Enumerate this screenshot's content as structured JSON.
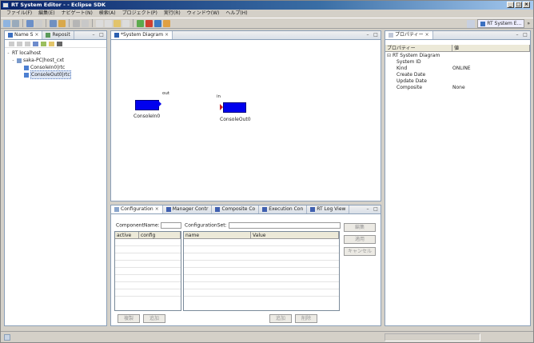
{
  "window": {
    "title": "RT System Editor - - Eclipse SDK",
    "controls": [
      "_",
      "□",
      "×"
    ]
  },
  "menu": [
    "ファイル(F)",
    "編集(E)",
    "ナビゲート(N)",
    "検索(A)",
    "プロジェクト(P)",
    "実行(R)",
    "ウィンドウ(W)",
    "ヘルプ(H)"
  ],
  "perspective": {
    "label": "RT System E..."
  },
  "navigator": {
    "tabs": [
      {
        "label": "Name S",
        "close": "×"
      },
      {
        "label": "Reposit",
        "close": "×"
      }
    ],
    "tree": [
      {
        "label": "RT localhost",
        "prefix": "-"
      },
      {
        "label": "saka-PC|host_cxt",
        "prefix": "-"
      },
      {
        "label": "ConsoleIn0|rtc",
        "prefix": ""
      },
      {
        "label": "ConsoleOut0|rtc",
        "prefix": ""
      }
    ]
  },
  "diagram": {
    "tab": "*System Diagram",
    "components": [
      {
        "name": "ConsoleIn0",
        "port": "out"
      },
      {
        "name": "ConsoleOut0",
        "port": "in"
      }
    ]
  },
  "bottom": {
    "tabs": [
      "Configuration",
      "Manager Contr",
      "Composite Co",
      "Execution Con",
      "RT Log View"
    ],
    "component_name_label": "ComponentName:",
    "configuration_set_label": "ConfigurationSet:",
    "left_columns": [
      "active",
      "config"
    ],
    "right_columns": [
      "name",
      "Value"
    ],
    "side_buttons": [
      "編集",
      "適用",
      "キャンセル"
    ],
    "bottom_left_buttons": [
      "複製",
      "追加"
    ],
    "bottom_right_buttons": [
      "追加",
      "削除"
    ]
  },
  "properties": {
    "tab": "プロパティー",
    "columns": [
      "プロパティー",
      "値"
    ],
    "rows": [
      {
        "key": "RT System Diagram",
        "value": "",
        "group": true
      },
      {
        "key": "System ID",
        "value": ""
      },
      {
        "key": "Kind",
        "value": "ONLINE"
      },
      {
        "key": "Create Date",
        "value": ""
      },
      {
        "key": "Update Date",
        "value": ""
      },
      {
        "key": "Composite",
        "value": "None"
      }
    ]
  },
  "colors": {
    "component": "#0000ee",
    "accent": "#0a246a"
  }
}
